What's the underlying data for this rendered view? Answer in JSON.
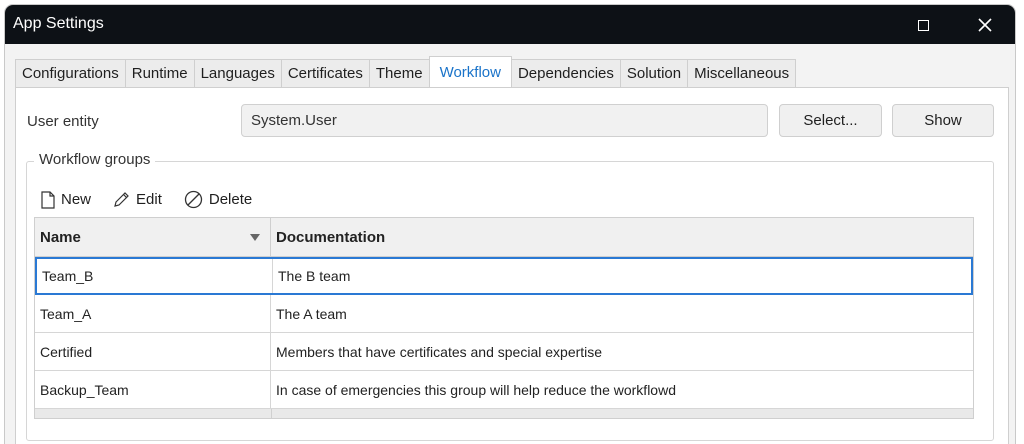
{
  "window": {
    "title": "App Settings",
    "controls": {
      "maximize": "maximize-icon",
      "close": "close-icon"
    }
  },
  "tabs": [
    {
      "label": "Configurations",
      "active": false
    },
    {
      "label": "Runtime",
      "active": false
    },
    {
      "label": "Languages",
      "active": false
    },
    {
      "label": "Certificates",
      "active": false
    },
    {
      "label": "Theme",
      "active": false
    },
    {
      "label": "Workflow",
      "active": true
    },
    {
      "label": "Dependencies",
      "active": false
    },
    {
      "label": "Solution",
      "active": false
    },
    {
      "label": "Miscellaneous",
      "active": false
    }
  ],
  "user_entity": {
    "label": "User entity",
    "value": "System.User",
    "select_label": "Select...",
    "show_label": "Show"
  },
  "workflow_groups": {
    "legend": "Workflow groups",
    "toolbar": {
      "new_label": "New",
      "edit_label": "Edit",
      "delete_label": "Delete"
    },
    "columns": {
      "name": "Name",
      "documentation": "Documentation"
    },
    "rows": [
      {
        "name": "Team_B",
        "documentation": "The B team",
        "selected": true
      },
      {
        "name": "Team_A",
        "documentation": "The A team",
        "selected": false
      },
      {
        "name": "Certified",
        "documentation": "Members that have certificates and special expertise",
        "selected": false
      },
      {
        "name": "Backup_Team",
        "documentation": "In case of emergencies this group will help reduce the workflowd",
        "selected": false
      }
    ]
  },
  "colors": {
    "titlebar": "#0d1116",
    "active_tab_text": "#1a73c9",
    "selection_border": "#2a79d4"
  }
}
